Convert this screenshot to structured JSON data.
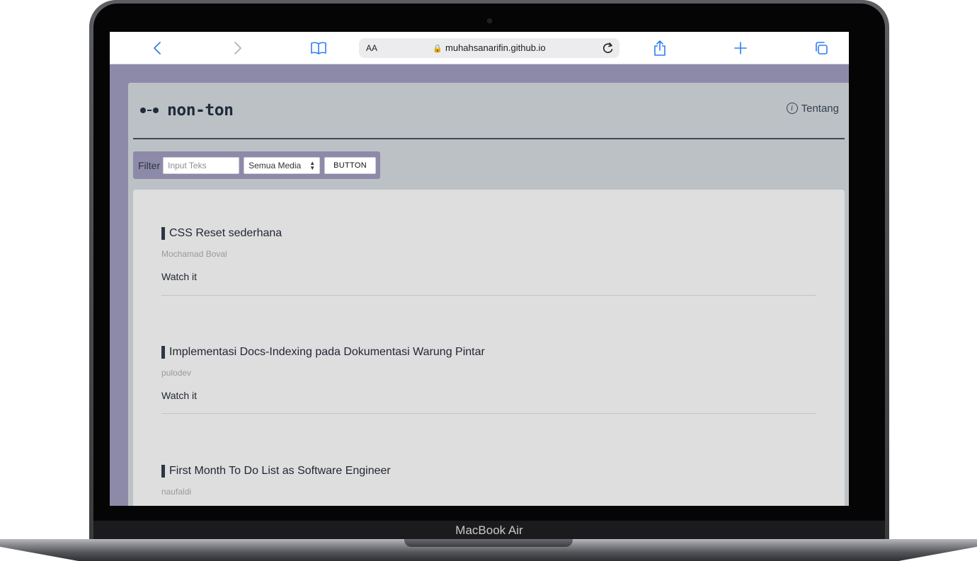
{
  "device": {
    "label": "MacBook Air"
  },
  "browser": {
    "address_prefix": "AA",
    "url": "muhahsanarifin.github.io"
  },
  "site": {
    "logo_text": "non-ton",
    "about_label": "Tentang",
    "filter": {
      "label": "Filter",
      "input_placeholder": "Input Teks",
      "input_value": "",
      "select_value": "Semua Media",
      "button_label": "BUTTON"
    },
    "articles": [
      {
        "title": "CSS Reset sederhana",
        "author": "Mochamad Boval",
        "link": "Watch it"
      },
      {
        "title": "Implementasi Docs-Indexing pada Dokumentasi Warung Pintar",
        "author": "pulodev",
        "link": "Watch it"
      },
      {
        "title": "First Month To Do List as Software Engineer",
        "author": "naufaldi",
        "link": ""
      }
    ]
  },
  "colors": {
    "page_background": "#8d8aa9",
    "header_background": "#bcc1c6",
    "content_background": "#dedede",
    "accent": "#2c3645",
    "browser_icon": "#2f7bf6"
  },
  "icons": {
    "toolbar": [
      "back-icon",
      "forward-icon",
      "bookmarks-icon",
      "reload-icon",
      "share-icon",
      "new-tab-icon",
      "tabs-icon"
    ],
    "site": [
      "logo-mark-icon",
      "info-icon"
    ]
  }
}
